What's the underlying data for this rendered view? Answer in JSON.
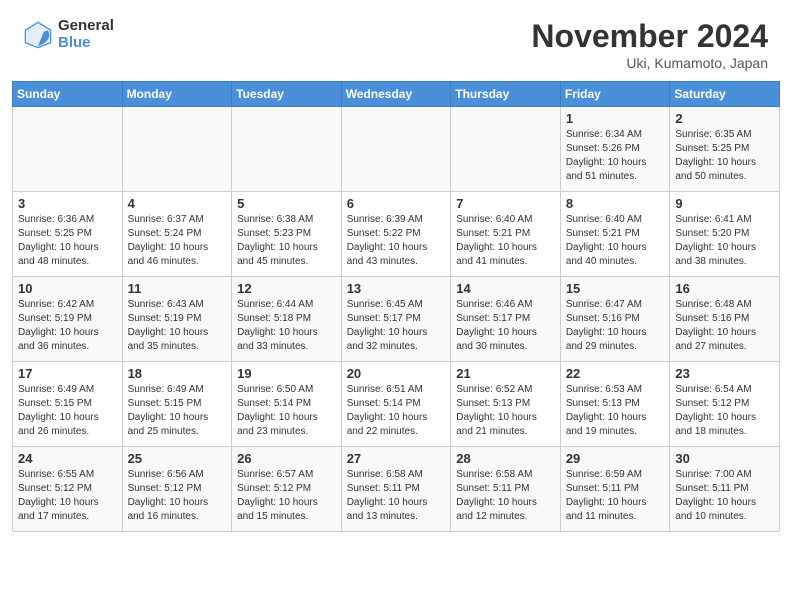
{
  "header": {
    "logo_general": "General",
    "logo_blue": "Blue",
    "month": "November 2024",
    "location": "Uki, Kumamoto, Japan"
  },
  "weekdays": [
    "Sunday",
    "Monday",
    "Tuesday",
    "Wednesday",
    "Thursday",
    "Friday",
    "Saturday"
  ],
  "weeks": [
    [
      {
        "day": "",
        "info": ""
      },
      {
        "day": "",
        "info": ""
      },
      {
        "day": "",
        "info": ""
      },
      {
        "day": "",
        "info": ""
      },
      {
        "day": "",
        "info": ""
      },
      {
        "day": "1",
        "info": "Sunrise: 6:34 AM\nSunset: 5:26 PM\nDaylight: 10 hours\nand 51 minutes."
      },
      {
        "day": "2",
        "info": "Sunrise: 6:35 AM\nSunset: 5:25 PM\nDaylight: 10 hours\nand 50 minutes."
      }
    ],
    [
      {
        "day": "3",
        "info": "Sunrise: 6:36 AM\nSunset: 5:25 PM\nDaylight: 10 hours\nand 48 minutes."
      },
      {
        "day": "4",
        "info": "Sunrise: 6:37 AM\nSunset: 5:24 PM\nDaylight: 10 hours\nand 46 minutes."
      },
      {
        "day": "5",
        "info": "Sunrise: 6:38 AM\nSunset: 5:23 PM\nDaylight: 10 hours\nand 45 minutes."
      },
      {
        "day": "6",
        "info": "Sunrise: 6:39 AM\nSunset: 5:22 PM\nDaylight: 10 hours\nand 43 minutes."
      },
      {
        "day": "7",
        "info": "Sunrise: 6:40 AM\nSunset: 5:21 PM\nDaylight: 10 hours\nand 41 minutes."
      },
      {
        "day": "8",
        "info": "Sunrise: 6:40 AM\nSunset: 5:21 PM\nDaylight: 10 hours\nand 40 minutes."
      },
      {
        "day": "9",
        "info": "Sunrise: 6:41 AM\nSunset: 5:20 PM\nDaylight: 10 hours\nand 38 minutes."
      }
    ],
    [
      {
        "day": "10",
        "info": "Sunrise: 6:42 AM\nSunset: 5:19 PM\nDaylight: 10 hours\nand 36 minutes."
      },
      {
        "day": "11",
        "info": "Sunrise: 6:43 AM\nSunset: 5:19 PM\nDaylight: 10 hours\nand 35 minutes."
      },
      {
        "day": "12",
        "info": "Sunrise: 6:44 AM\nSunset: 5:18 PM\nDaylight: 10 hours\nand 33 minutes."
      },
      {
        "day": "13",
        "info": "Sunrise: 6:45 AM\nSunset: 5:17 PM\nDaylight: 10 hours\nand 32 minutes."
      },
      {
        "day": "14",
        "info": "Sunrise: 6:46 AM\nSunset: 5:17 PM\nDaylight: 10 hours\nand 30 minutes."
      },
      {
        "day": "15",
        "info": "Sunrise: 6:47 AM\nSunset: 5:16 PM\nDaylight: 10 hours\nand 29 minutes."
      },
      {
        "day": "16",
        "info": "Sunrise: 6:48 AM\nSunset: 5:16 PM\nDaylight: 10 hours\nand 27 minutes."
      }
    ],
    [
      {
        "day": "17",
        "info": "Sunrise: 6:49 AM\nSunset: 5:15 PM\nDaylight: 10 hours\nand 26 minutes."
      },
      {
        "day": "18",
        "info": "Sunrise: 6:49 AM\nSunset: 5:15 PM\nDaylight: 10 hours\nand 25 minutes."
      },
      {
        "day": "19",
        "info": "Sunrise: 6:50 AM\nSunset: 5:14 PM\nDaylight: 10 hours\nand 23 minutes."
      },
      {
        "day": "20",
        "info": "Sunrise: 6:51 AM\nSunset: 5:14 PM\nDaylight: 10 hours\nand 22 minutes."
      },
      {
        "day": "21",
        "info": "Sunrise: 6:52 AM\nSunset: 5:13 PM\nDaylight: 10 hours\nand 21 minutes."
      },
      {
        "day": "22",
        "info": "Sunrise: 6:53 AM\nSunset: 5:13 PM\nDaylight: 10 hours\nand 19 minutes."
      },
      {
        "day": "23",
        "info": "Sunrise: 6:54 AM\nSunset: 5:12 PM\nDaylight: 10 hours\nand 18 minutes."
      }
    ],
    [
      {
        "day": "24",
        "info": "Sunrise: 6:55 AM\nSunset: 5:12 PM\nDaylight: 10 hours\nand 17 minutes."
      },
      {
        "day": "25",
        "info": "Sunrise: 6:56 AM\nSunset: 5:12 PM\nDaylight: 10 hours\nand 16 minutes."
      },
      {
        "day": "26",
        "info": "Sunrise: 6:57 AM\nSunset: 5:12 PM\nDaylight: 10 hours\nand 15 minutes."
      },
      {
        "day": "27",
        "info": "Sunrise: 6:58 AM\nSunset: 5:11 PM\nDaylight: 10 hours\nand 13 minutes."
      },
      {
        "day": "28",
        "info": "Sunrise: 6:58 AM\nSunset: 5:11 PM\nDaylight: 10 hours\nand 12 minutes."
      },
      {
        "day": "29",
        "info": "Sunrise: 6:59 AM\nSunset: 5:11 PM\nDaylight: 10 hours\nand 11 minutes."
      },
      {
        "day": "30",
        "info": "Sunrise: 7:00 AM\nSunset: 5:11 PM\nDaylight: 10 hours\nand 10 minutes."
      }
    ]
  ]
}
